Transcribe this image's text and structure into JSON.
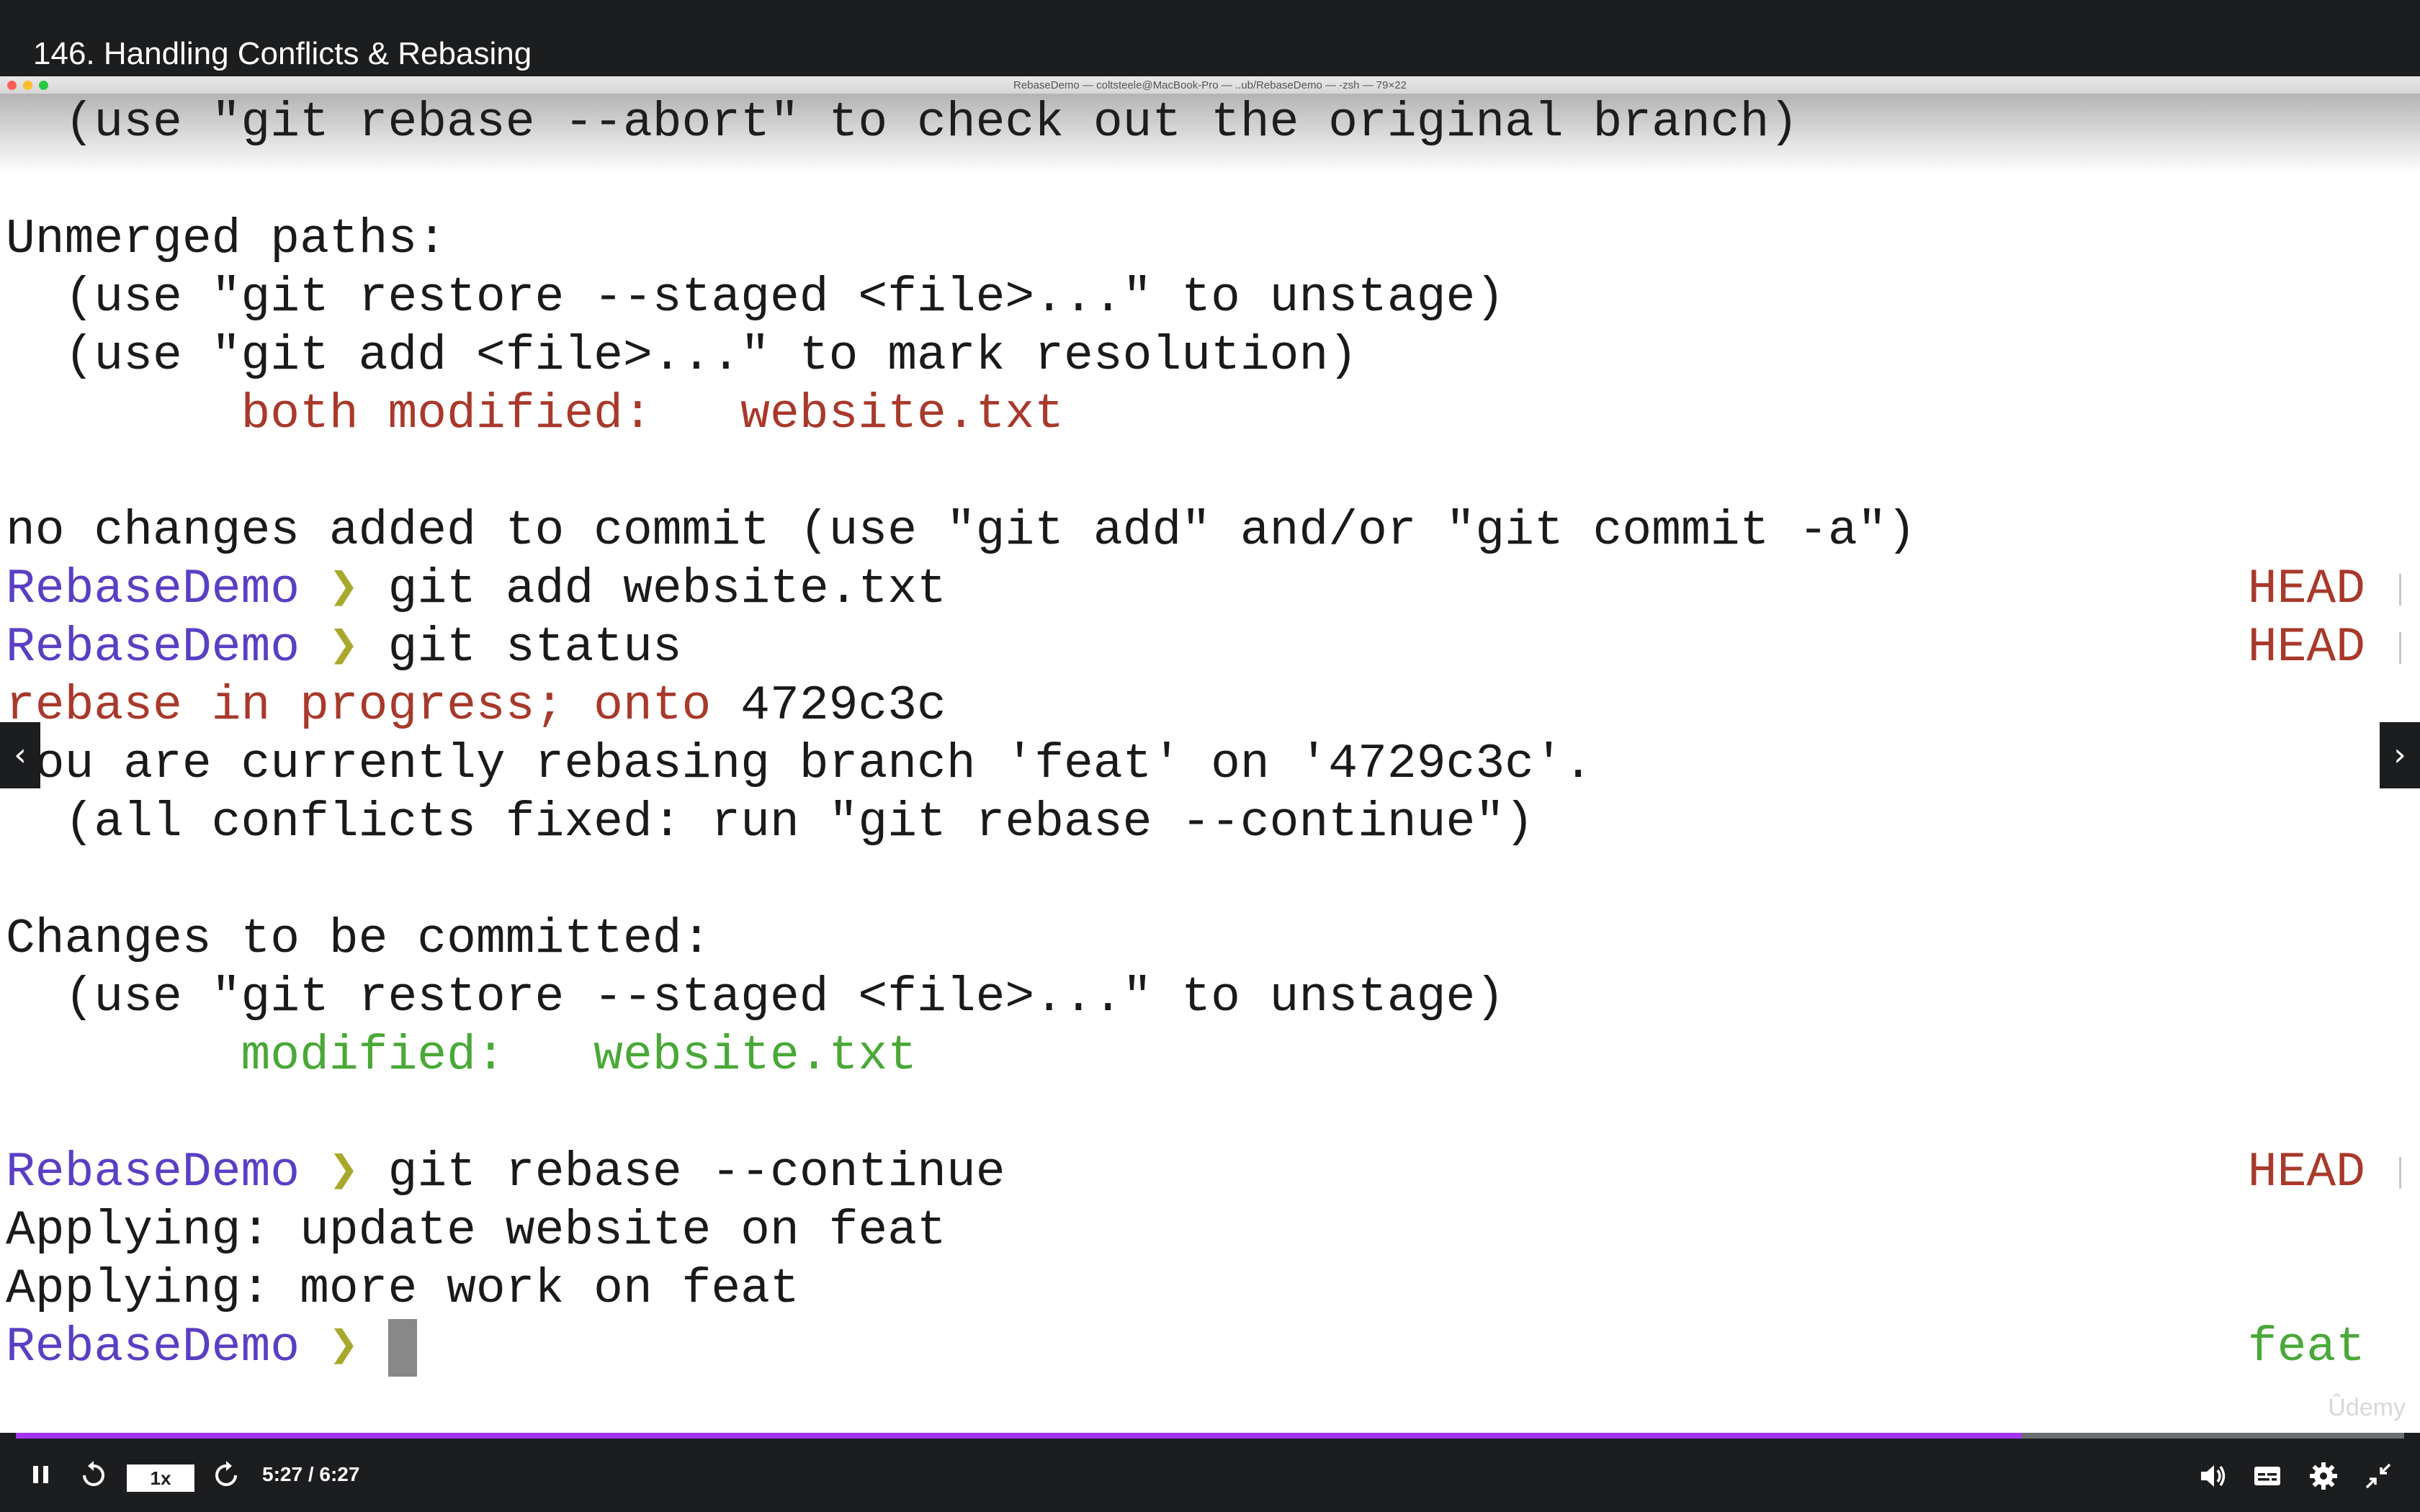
{
  "video": {
    "title": "146. Handling Conflicts & Rebasing",
    "watermark": "Ûdemy"
  },
  "terminal": {
    "window_title": "RebaseDemo — coltsteele@MacBook-Pro — ..ub/RebaseDemo — -zsh — 79×22",
    "lines": [
      "  (use \"git rebase --abort\" to check out the original branch)",
      "Unmerged paths:",
      "  (use \"git restore --staged <file>...\" to unstage)",
      "  (use \"git add <file>...\" to mark resolution)",
      "        both modified:   website.txt",
      "no changes added to commit (use \"git add\" and/or \"git commit -a\")",
      "git add website.txt",
      "git status",
      "rebase in progress; onto",
      "4729c3c",
      "You are currently rebasing branch 'feat' on '4729c3c'.",
      "  (all conflicts fixed: run \"git rebase --continue\")",
      "Changes to be committed:",
      "  (use \"git restore --staged <file>...\" to unstage)",
      "        modified:   website.txt",
      "git rebase --continue",
      "Applying: update website on feat",
      "Applying: more work on feat"
    ],
    "prompt_dir": "RebaseDemo",
    "prompt_symbol": "❯",
    "branch_head": "HEAD",
    "branch_feat": "feat"
  },
  "player": {
    "speed": "1x",
    "time": "5:27 / 6:27",
    "progress_fraction": 0.84
  },
  "colors": {
    "accent": "#a435f0",
    "prompt_dir": "#5a3fc4",
    "error_red": "#a8392b",
    "staged_green": "#4aa838"
  },
  "icons": [
    "pause-icon",
    "rewind-icon",
    "forward-icon",
    "volume-icon",
    "captions-icon",
    "settings-icon",
    "fullscreen-exit-icon",
    "prev-arrow-icon",
    "next-arrow-icon"
  ]
}
